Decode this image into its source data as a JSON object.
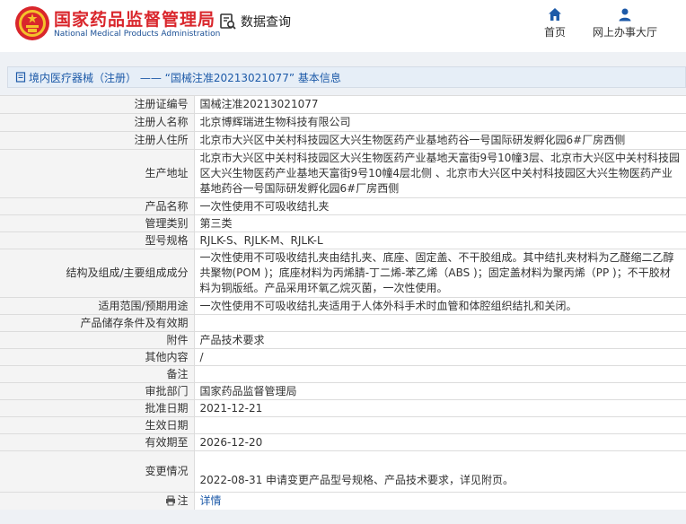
{
  "header": {
    "org_name_cn": "国家药品监督管理局",
    "org_name_en": "National Medical Products Administration",
    "query_label": "数据查询",
    "nav": [
      {
        "label": "首页",
        "icon": "home-icon"
      },
      {
        "label": "网上办事大厅",
        "icon": "user-icon"
      }
    ]
  },
  "title": "境内医疗器械（注册） —— “国械注准20213021077” 基本信息",
  "rows": [
    {
      "label": "注册证编号",
      "value": "国械注准20213021077"
    },
    {
      "label": "注册人名称",
      "value": "北京博辉瑞进生物科技有限公司"
    },
    {
      "label": "注册人住所",
      "value": "北京市大兴区中关村科技园区大兴生物医药产业基地药谷一号国际研发孵化园6#厂房西侧"
    },
    {
      "label": "生产地址",
      "value": "北京市大兴区中关村科技园区大兴生物医药产业基地天富街9号10幢3层、北京市大兴区中关村科技园区大兴生物医药产业基地天富街9号10幢4层北侧 、北京市大兴区中关村科技园区大兴生物医药产业基地药谷一号国际研发孵化园6#厂房西侧"
    },
    {
      "label": "产品名称",
      "value": "一次性使用不可吸收结扎夹"
    },
    {
      "label": "管理类别",
      "value": "第三类"
    },
    {
      "label": "型号规格",
      "value": "RJLK-S、RJLK-M、RJLK-L"
    },
    {
      "label": "结构及组成/主要组成成分",
      "value": "一次性使用不可吸收结扎夹由结扎夹、底座、固定盖、不干胶组成。其中结扎夹材料为乙醛缩二乙醇共聚物(POM )；底座材料为丙烯腈-丁二烯-苯乙烯（ABS )；固定盖材料为聚丙烯（PP )；不干胶材料为铜版纸。产品采用环氧乙烷灭菌，一次性使用。"
    },
    {
      "label": "适用范围/预期用途",
      "value": "一次性使用不可吸收结扎夹适用于人体外科手术时血管和体腔组织结扎和关闭。"
    },
    {
      "label": "产品储存条件及有效期",
      "value": ""
    },
    {
      "label": "附件",
      "value": "产品技术要求"
    },
    {
      "label": "其他内容",
      "value": "/"
    },
    {
      "label": "备注",
      "value": ""
    },
    {
      "label": "审批部门",
      "value": "国家药品监督管理局"
    },
    {
      "label": "批准日期",
      "value": "2021-12-21"
    },
    {
      "label": "生效日期",
      "value": ""
    },
    {
      "label": "有效期至",
      "value": "2026-12-20"
    },
    {
      "label": "变更情况",
      "value": "2022-08-31 申请变更产品型号规格、产品技术要求，详见附页。"
    },
    {
      "label": "注",
      "value": "详情"
    }
  ],
  "colors": {
    "brand_red": "#d9262c",
    "brand_blue": "#1a4f95",
    "link_blue": "#1d5aa8"
  }
}
